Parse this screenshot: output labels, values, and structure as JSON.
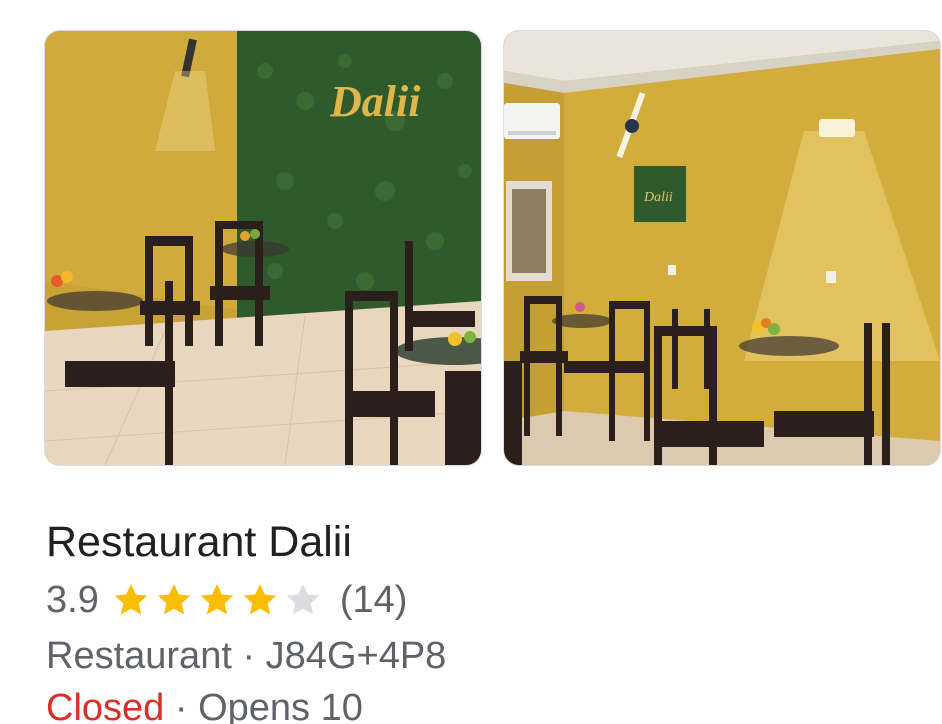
{
  "place": {
    "name": "Restaurant Dalii",
    "rating": "3.9",
    "rating_fraction": 0.78,
    "stars_total": 5,
    "stars_filled": 4,
    "review_count": "(14)",
    "category": "Restaurant",
    "separator": " · ",
    "plus_code": "J84G+4P8",
    "hours_status": "Closed",
    "hours_separator": " · ",
    "hours_detail": "Opens 10"
  },
  "photos": [
    {
      "name": "restaurant-dalii-dining-room",
      "sign_text": "Dalii"
    },
    {
      "name": "restaurant-dalii-side-room",
      "sign_text": "Dalii"
    }
  ],
  "colors": {
    "star_filled": "#fbbc04",
    "star_empty": "#dadce0",
    "closed": "#d93025",
    "secondary_text": "#5f6368",
    "primary_text": "#202124",
    "wall_yellow": "#cfa83a",
    "green_wall": "#2f5a2c"
  }
}
